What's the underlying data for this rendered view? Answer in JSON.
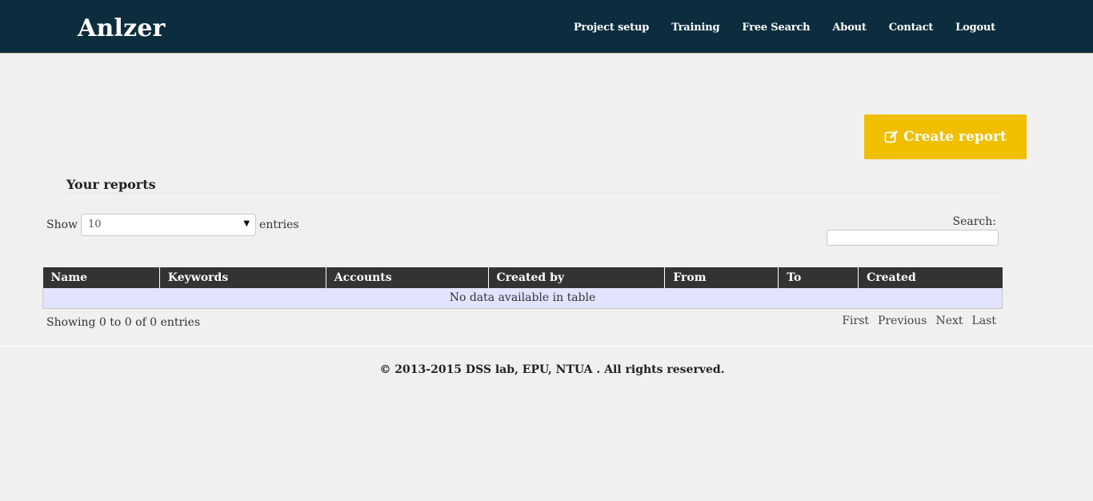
{
  "nav": {
    "brand": "Anlzer",
    "links": [
      "Project setup",
      "Training",
      "Free Search",
      "About",
      "Contact",
      "Logout"
    ]
  },
  "actions": {
    "create_report_label": "Create report",
    "create_report_icon": "edit-icon"
  },
  "reports": {
    "title": "Your reports",
    "length": {
      "prefix": "Show",
      "selected": "10",
      "suffix": "entries"
    },
    "search_label": "Search:",
    "search_value": "",
    "columns": [
      "Name",
      "Keywords",
      "Accounts",
      "Created by",
      "From",
      "To",
      "Created"
    ],
    "empty_message": "No data available in table",
    "info": "Showing 0 to 0 of 0 entries",
    "pagination": [
      "First",
      "Previous",
      "Next",
      "Last"
    ]
  },
  "footer": {
    "copyright": "© 2013-2015 DSS lab, EPU, NTUA . All rights reserved."
  },
  "colors": {
    "navbar_bg": "#0c2d3e",
    "accent": "#f0bf00",
    "table_header_bg": "#333333",
    "empty_row_bg": "#e2e4ff",
    "page_bg": "#f0f0f0"
  }
}
